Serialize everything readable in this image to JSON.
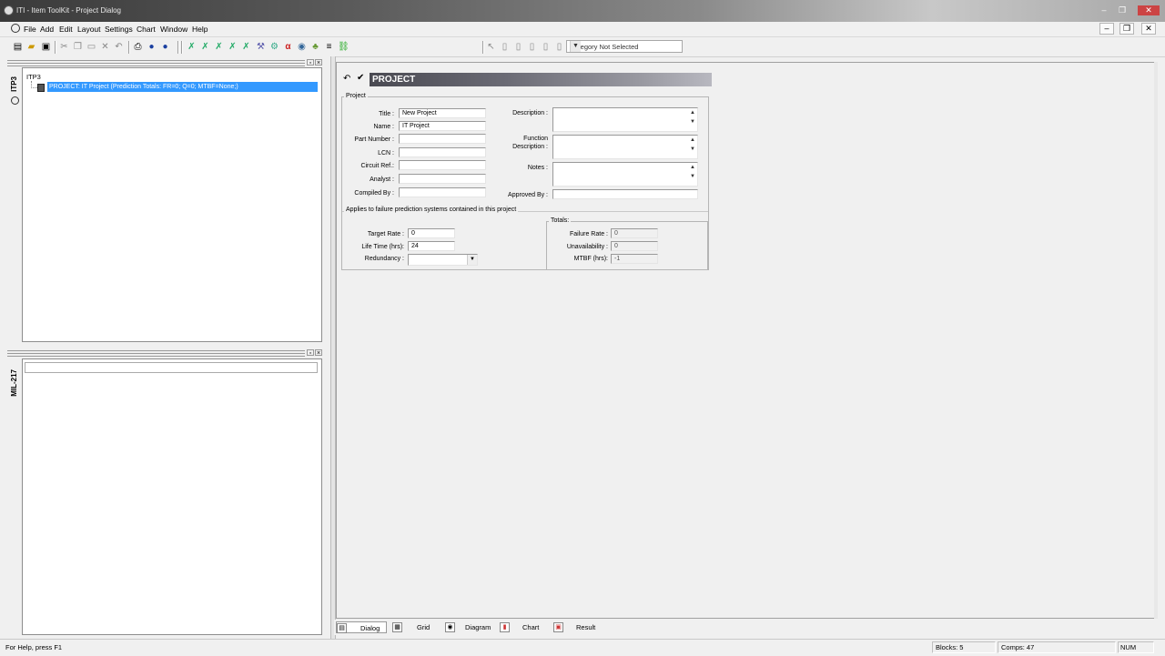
{
  "window": {
    "title": "ITI - Item ToolKit - Project Dialog",
    "controls": [
      "‒",
      "❐",
      "✕"
    ],
    "mdi_controls": [
      "‒",
      "❐",
      "✕"
    ]
  },
  "menu": [
    "File",
    "Add",
    "Edit",
    "Layout",
    "Settings",
    "Chart",
    "Window",
    "Help"
  ],
  "toolbar": {
    "category_select": "Category Not Selected"
  },
  "tree_panel": {
    "vertical_tab": "ITP3",
    "root": "ITP3",
    "selected_item": "PROJECT:  IT Project (Prediction Totals:  FR=0; Q=0; MTBF=None;)"
  },
  "lower_panel": {
    "vertical_tab": "MIL-217"
  },
  "dialog": {
    "header": "PROJECT",
    "group_label": "Project",
    "labels": {
      "title": "Title :",
      "name": "Name :",
      "part_number": "Part Number :",
      "lcn": "LCN :",
      "circuit_ref": "Circuit Ref.:",
      "analyst": "Analyst :",
      "compiled_by": "Compiled By :",
      "description": "Description :",
      "function_description": "Function\nDescription :",
      "notes": "Notes :",
      "approved_by": "Approved By :"
    },
    "values": {
      "title": "New Project",
      "name": "IT Project",
      "part_number": "",
      "lcn": "",
      "circuit_ref": "",
      "analyst": "",
      "compiled_by": "",
      "approved_by": ""
    },
    "applies_label": "Applies to failure prediction systems contained in this project",
    "target_rate_label": "Target Rate :",
    "target_rate": "0",
    "life_time_label": "Life Time (hrs):",
    "life_time": "24",
    "redundancy_label": "Redundancy :",
    "redundancy": "",
    "totals": {
      "label": "Totals:",
      "failure_rate_label": "Failure Rate :",
      "failure_rate": "0",
      "unavailability_label": "Unavailability :",
      "unavailability": "0",
      "mtbf_label": "MTBF (hrs):",
      "mtbf": "-1"
    }
  },
  "view_tabs": [
    "Dialog",
    "Grid",
    "Diagram",
    "Chart",
    "Result"
  ],
  "status": {
    "help": "For Help, press F1",
    "blocks": "Blocks: 5",
    "comps": "Comps: 47",
    "num": "NUM"
  }
}
